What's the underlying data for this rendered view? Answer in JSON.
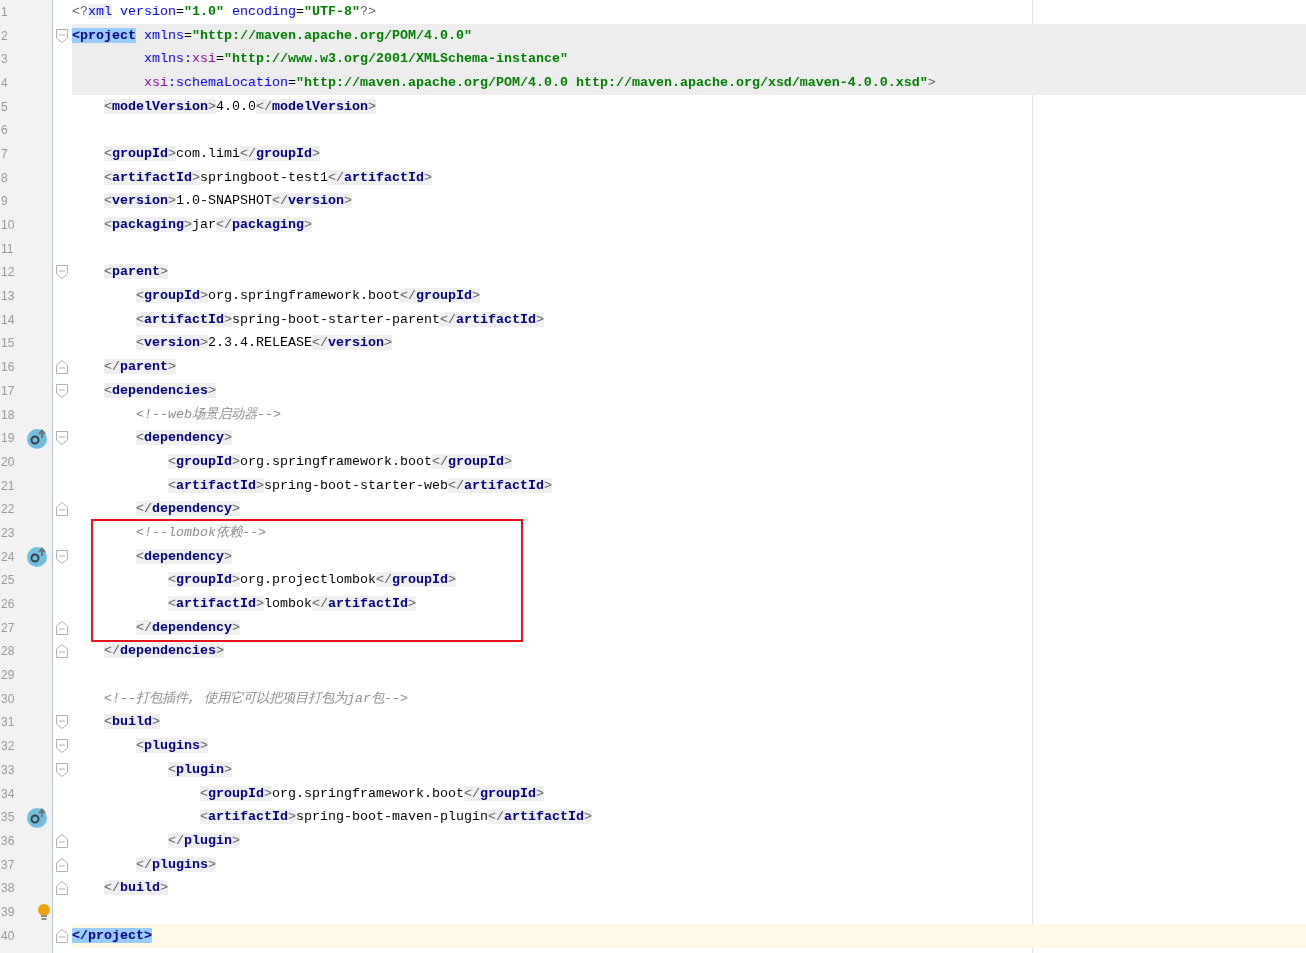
{
  "lines": [
    {
      "number": "1",
      "tokens": [
        {
          "kind": "bracket",
          "text": "<?"
        },
        {
          "kind": "pi",
          "text": "xml"
        },
        {
          "kind": "attr",
          "text": " version"
        },
        {
          "kind": "text",
          "text": "="
        },
        {
          "kind": "value",
          "text": "\"1.0\""
        },
        {
          "kind": "attr",
          "text": " encoding"
        },
        {
          "kind": "text",
          "text": "="
        },
        {
          "kind": "value",
          "text": "\"UTF-8\""
        },
        {
          "kind": "bracket",
          "text": "?>"
        }
      ]
    },
    {
      "number": "2",
      "gutter": [
        {
          "kind": "fold_start"
        }
      ],
      "band": {
        "kind": "scope"
      },
      "tokens": [
        {
          "kind": "matched_tag",
          "text": "<project"
        },
        {
          "kind": "attr",
          "text": " xmlns"
        },
        {
          "kind": "text",
          "text": "="
        },
        {
          "kind": "value",
          "text": "\"http://maven.apache.org/POM/4.0.0\""
        }
      ],
      "continuation_lines": [
        {
          "number": "3",
          "band": {
            "kind": "scope"
          },
          "tokens": [
            {
              "kind": "attr",
              "text": "xmlns:"
            },
            {
              "kind": "ns",
              "text": "xsi"
            },
            {
              "kind": "text",
              "text": "="
            },
            {
              "kind": "value",
              "text": "\"http://www.w3.org/2001/XMLSchema-instance\""
            }
          ]
        },
        {
          "number": "4",
          "band": {
            "kind": "scope"
          },
          "tokens": [
            {
              "kind": "ns",
              "text": "xsi"
            },
            {
              "kind": "attr",
              "text": ":schemaLocation"
            },
            {
              "kind": "text",
              "text": "="
            },
            {
              "kind": "value",
              "text": "\"http://maven.apache.org/POM/4.0.0 http://maven.apache.org/xsd/maven-4.0.0.xsd\""
            },
            {
              "kind": "bracket",
              "text": ">"
            }
          ]
        }
      ],
      "children": [
        {
          "number": "5",
          "tokens": [
            {
              "kind": "tag",
              "open": "<",
              "name": "modelVersion",
              "close": ">"
            },
            {
              "kind": "text",
              "text": "4.0.0"
            },
            {
              "kind": "tag",
              "open": "</",
              "name": "modelVersion",
              "close": ">"
            }
          ]
        },
        {
          "number": "6"
        },
        {
          "number": "7",
          "tokens": [
            {
              "kind": "tag",
              "open": "<",
              "name": "groupId",
              "close": ">"
            },
            {
              "kind": "text",
              "text": "com.limi"
            },
            {
              "kind": "tag",
              "open": "</",
              "name": "groupId",
              "close": ">"
            }
          ]
        },
        {
          "number": "8",
          "tokens": [
            {
              "kind": "tag",
              "open": "<",
              "name": "artifactId",
              "close": ">"
            },
            {
              "kind": "text",
              "text": "springboot-test1"
            },
            {
              "kind": "tag",
              "open": "</",
              "name": "artifactId",
              "close": ">"
            }
          ]
        },
        {
          "number": "9",
          "tokens": [
            {
              "kind": "tag",
              "open": "<",
              "name": "version",
              "close": ">"
            },
            {
              "kind": "text",
              "text": "1.0-SNAPSHOT"
            },
            {
              "kind": "tag",
              "open": "</",
              "name": "version",
              "close": ">"
            }
          ]
        },
        {
          "number": "10",
          "tokens": [
            {
              "kind": "tag",
              "open": "<",
              "name": "packaging",
              "close": ">"
            },
            {
              "kind": "text",
              "text": "jar"
            },
            {
              "kind": "tag",
              "open": "</",
              "name": "packaging",
              "close": ">"
            }
          ]
        },
        {
          "number": "11"
        },
        {
          "number": "12",
          "gutter": [
            {
              "kind": "fold_start"
            }
          ],
          "tokens": [
            {
              "kind": "tag",
              "open": "<",
              "name": "parent",
              "close": ">"
            }
          ],
          "children": [
            {
              "number": "13",
              "tokens": [
                {
                  "kind": "tag",
                  "open": "<",
                  "name": "groupId",
                  "close": ">"
                },
                {
                  "kind": "text",
                  "text": "org.springframework.boot"
                },
                {
                  "kind": "tag",
                  "open": "</",
                  "name": "groupId",
                  "close": ">"
                }
              ]
            },
            {
              "number": "14",
              "tokens": [
                {
                  "kind": "tag",
                  "open": "<",
                  "name": "artifactId",
                  "close": ">"
                },
                {
                  "kind": "text",
                  "text": "spring-boot-starter-parent"
                },
                {
                  "kind": "tag",
                  "open": "</",
                  "name": "artifactId",
                  "close": ">"
                }
              ]
            },
            {
              "number": "15",
              "tokens": [
                {
                  "kind": "tag",
                  "open": "<",
                  "name": "version",
                  "close": ">"
                },
                {
                  "kind": "text",
                  "text": "2.3.4.RELEASE"
                },
                {
                  "kind": "tag",
                  "open": "</",
                  "name": "version",
                  "close": ">"
                }
              ]
            }
          ]
        },
        {
          "number": "16",
          "gutter": [
            {
              "kind": "fold_end"
            }
          ],
          "tokens": [
            {
              "kind": "tag",
              "open": "</",
              "name": "parent",
              "close": ">"
            }
          ]
        },
        {
          "number": "17",
          "gutter": [
            {
              "kind": "fold_start"
            }
          ],
          "tokens": [
            {
              "kind": "tag",
              "open": "<",
              "name": "dependencies",
              "close": ">"
            }
          ],
          "children": [
            {
              "number": "18",
              "tokens": [
                {
                  "kind": "comment",
                  "text": "<!--web场景启动器-->"
                }
              ]
            },
            {
              "number": "19",
              "gutter": [
                {
                  "kind": "override"
                },
                {
                  "kind": "fold_start"
                }
              ],
              "tokens": [
                {
                  "kind": "tag",
                  "open": "<",
                  "name": "dependency",
                  "close": ">"
                }
              ],
              "children": [
                {
                  "number": "20",
                  "tokens": [
                    {
                      "kind": "tag",
                      "open": "<",
                      "name": "groupId",
                      "close": ">"
                    },
                    {
                      "kind": "text",
                      "text": "org.springframework.boot"
                    },
                    {
                      "kind": "tag",
                      "open": "</",
                      "name": "groupId",
                      "close": ">"
                    }
                  ]
                },
                {
                  "number": "21",
                  "tokens": [
                    {
                      "kind": "tag",
                      "open": "<",
                      "name": "artifactId",
                      "close": ">"
                    },
                    {
                      "kind": "text",
                      "text": "spring-boot-starter-web"
                    },
                    {
                      "kind": "tag",
                      "open": "</",
                      "name": "artifactId",
                      "close": ">"
                    }
                  ]
                }
              ]
            },
            {
              "number": "22",
              "gutter": [
                {
                  "kind": "fold_end"
                }
              ],
              "tokens": [
                {
                  "kind": "tag",
                  "open": "</",
                  "name": "dependency",
                  "close": ">"
                }
              ]
            },
            {
              "number": "23",
              "boxed": true,
              "tokens": [
                {
                  "kind": "comment",
                  "text": "<!--lombok依赖-->"
                }
              ]
            },
            {
              "number": "24",
              "boxed": true,
              "gutter": [
                {
                  "kind": "override"
                },
                {
                  "kind": "fold_start"
                }
              ],
              "tokens": [
                {
                  "kind": "tag",
                  "open": "<",
                  "name": "dependency",
                  "close": ">"
                }
              ],
              "children": [
                {
                  "number": "25",
                  "boxed": true,
                  "tokens": [
                    {
                      "kind": "tag",
                      "open": "<",
                      "name": "groupId",
                      "close": ">"
                    },
                    {
                      "kind": "text",
                      "text": "org.projectlombok"
                    },
                    {
                      "kind": "tag",
                      "open": "</",
                      "name": "groupId",
                      "close": ">"
                    }
                  ]
                },
                {
                  "number": "26",
                  "boxed": true,
                  "tokens": [
                    {
                      "kind": "tag",
                      "open": "<",
                      "name": "artifactId",
                      "close": ">"
                    },
                    {
                      "kind": "text",
                      "text": "lombok"
                    },
                    {
                      "kind": "tag",
                      "open": "</",
                      "name": "artifactId",
                      "close": ">"
                    }
                  ]
                }
              ]
            },
            {
              "number": "27",
              "boxed": true,
              "gutter": [
                {
                  "kind": "fold_end"
                }
              ],
              "tokens": [
                {
                  "kind": "tag",
                  "open": "</",
                  "name": "dependency",
                  "close": ">"
                }
              ]
            }
          ]
        },
        {
          "number": "28",
          "gutter": [
            {
              "kind": "fold_end"
            }
          ],
          "tokens": [
            {
              "kind": "tag",
              "open": "</",
              "name": "dependencies",
              "close": ">"
            }
          ]
        },
        {
          "number": "29"
        },
        {
          "number": "30",
          "tokens": [
            {
              "kind": "comment",
              "text": "<!--打包插件, 使用它可以把项目打包为jar包-->"
            }
          ]
        },
        {
          "number": "31",
          "gutter": [
            {
              "kind": "fold_start"
            }
          ],
          "tokens": [
            {
              "kind": "tag",
              "open": "<",
              "name": "build",
              "close": ">"
            }
          ],
          "children": [
            {
              "number": "32",
              "gutter": [
                {
                  "kind": "fold_start"
                }
              ],
              "tokens": [
                {
                  "kind": "tag",
                  "open": "<",
                  "name": "plugins",
                  "close": ">"
                }
              ],
              "children": [
                {
                  "number": "33",
                  "gutter": [
                    {
                      "kind": "fold_start"
                    }
                  ],
                  "tokens": [
                    {
                      "kind": "tag",
                      "open": "<",
                      "name": "plugin",
                      "close": ">"
                    }
                  ],
                  "children": [
                    {
                      "number": "34",
                      "tokens": [
                        {
                          "kind": "tag",
                          "open": "<",
                          "name": "groupId",
                          "close": ">"
                        },
                        {
                          "kind": "text",
                          "text": "org.springframework.boot"
                        },
                        {
                          "kind": "tag",
                          "open": "</",
                          "name": "groupId",
                          "close": ">"
                        }
                      ]
                    },
                    {
                      "number": "35",
                      "gutter": [
                        {
                          "kind": "override"
                        }
                      ],
                      "tokens": [
                        {
                          "kind": "tag",
                          "open": "<",
                          "name": "artifactId",
                          "close": ">"
                        },
                        {
                          "kind": "text",
                          "text": "spring-boot-maven-plugin"
                        },
                        {
                          "kind": "tag",
                          "open": "</",
                          "name": "artifactId",
                          "close": ">"
                        }
                      ]
                    }
                  ]
                },
                {
                  "number": "36",
                  "gutter": [
                    {
                      "kind": "fold_end"
                    }
                  ],
                  "tokens": [
                    {
                      "kind": "tag",
                      "open": "</",
                      "name": "plugin",
                      "close": ">"
                    }
                  ]
                }
              ]
            },
            {
              "number": "37",
              "gutter": [
                {
                  "kind": "fold_end"
                }
              ],
              "tokens": [
                {
                  "kind": "tag",
                  "open": "</",
                  "name": "plugins",
                  "close": ">"
                }
              ]
            }
          ]
        },
        {
          "number": "38",
          "gutter": [
            {
              "kind": "fold_end"
            }
          ],
          "tokens": [
            {
              "kind": "tag",
              "open": "</",
              "name": "build",
              "close": ">"
            }
          ]
        },
        {
          "number": "39",
          "gutter": [
            {
              "kind": "bulb"
            }
          ]
        }
      ]
    },
    {
      "number": "40",
      "gutter": [
        {
          "kind": "fold_end"
        }
      ],
      "band": {
        "kind": "current"
      },
      "tokens": [
        {
          "kind": "matched_tag",
          "text": "</project>"
        }
      ]
    }
  ]
}
